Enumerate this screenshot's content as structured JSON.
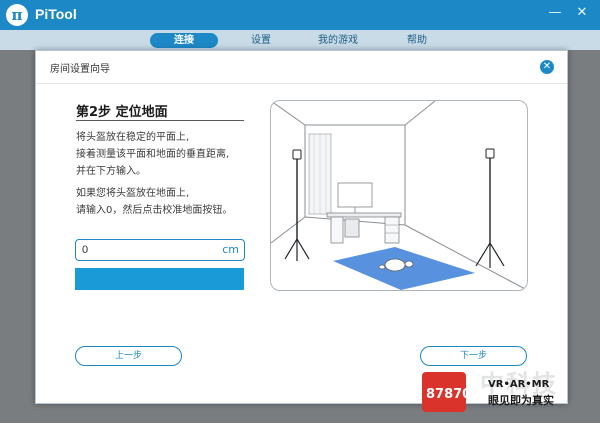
{
  "app": {
    "title": "PiTool",
    "logo_glyph": "π"
  },
  "window_controls": {
    "minimize": "—",
    "close": "✕"
  },
  "nav": {
    "tabs": [
      {
        "label": "连接",
        "active": true
      },
      {
        "label": "设置",
        "active": false
      },
      {
        "label": "我的游戏",
        "active": false
      },
      {
        "label": "帮助",
        "active": false
      }
    ]
  },
  "dialog": {
    "title": "房间设置向导",
    "close_glyph": "✕",
    "step_title": "第2步 定位地面",
    "instructions": {
      "line1": "将头盔放在稳定的平面上,",
      "line2": "接着测量该平面和地面的垂直距离,",
      "line3": "并在下方输入。",
      "line4": "如果您将头盔放在地面上,",
      "line5": "请输入0，然后点击校准地面按钮。"
    },
    "height_input": {
      "value": "0",
      "unit": "cm"
    },
    "calibrate_button_label": "",
    "prev_button": "上一步",
    "next_button": "下一步"
  },
  "watermark": {
    "logo_text": "87870",
    "big_text": "中科技",
    "line1": "VR•AR•MR",
    "line2": "眼见即为真实"
  },
  "colors": {
    "accent": "#1c89c6",
    "calibrate": "#1a9ad6",
    "floor_area": "#3b7fd9"
  }
}
